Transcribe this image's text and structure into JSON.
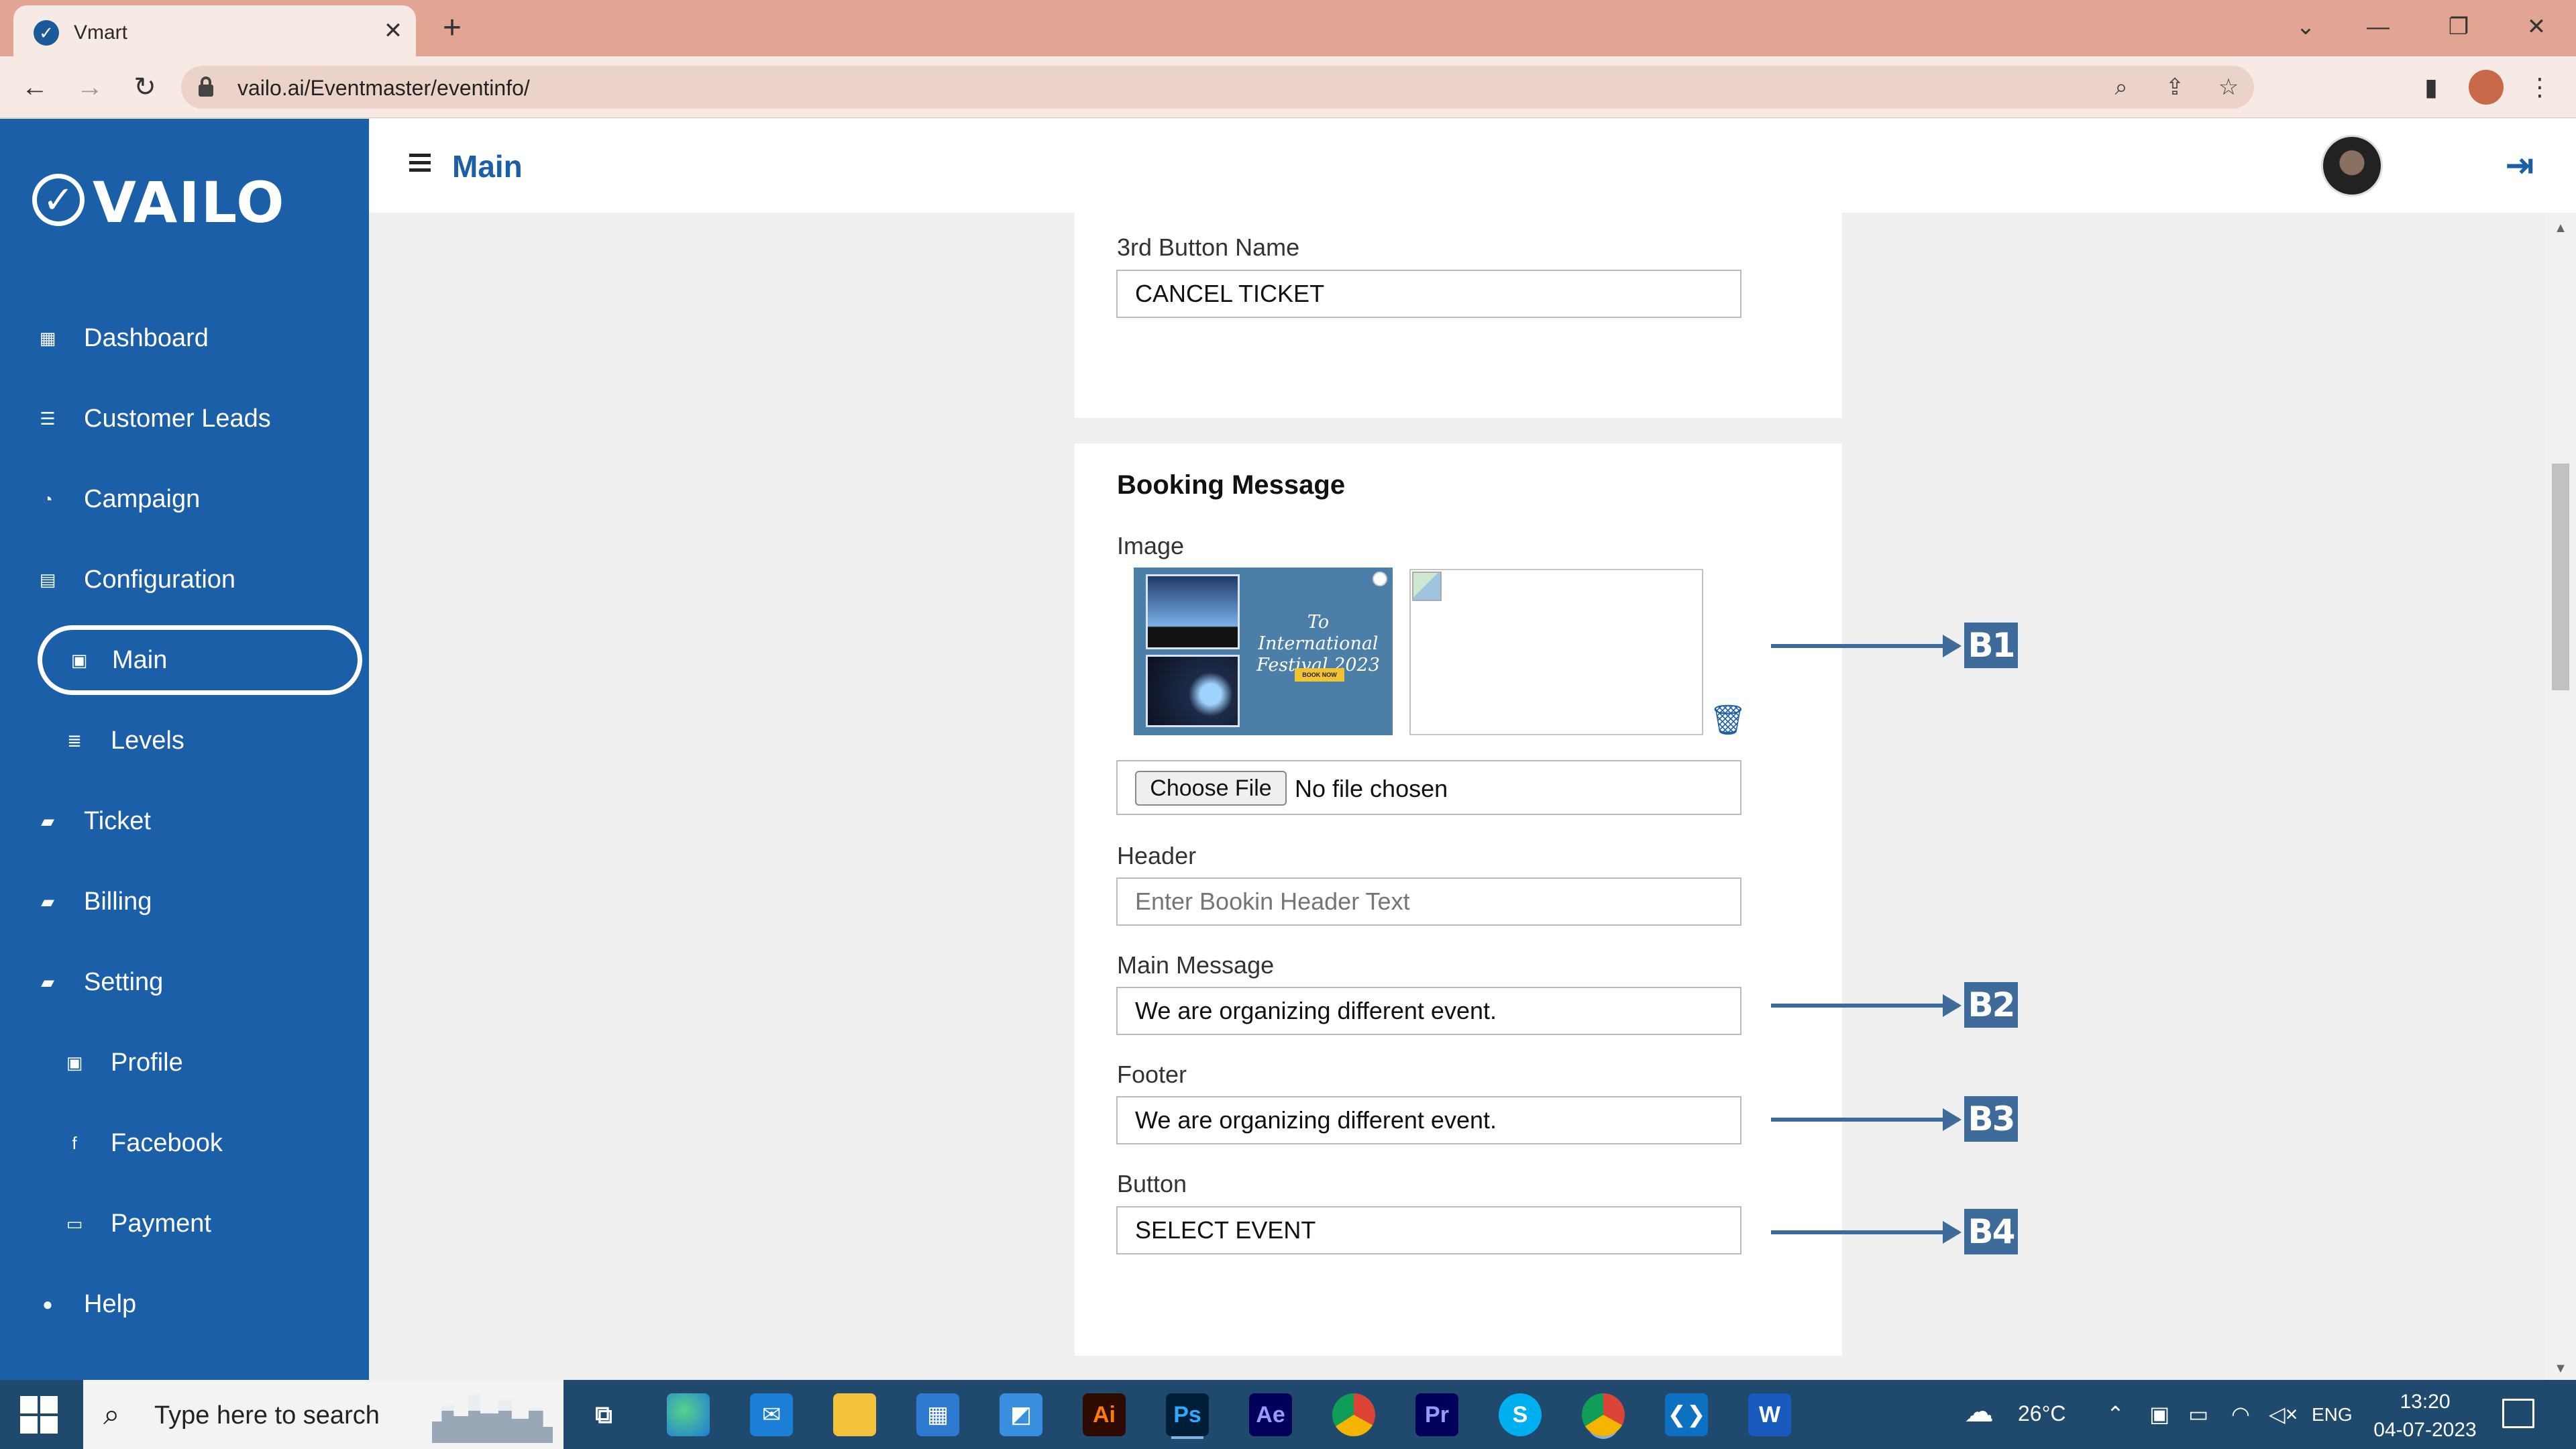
{
  "browser": {
    "tab_title": "Vmart",
    "tab_close": "✕",
    "new_tab": "+",
    "url": "vailo.ai/Eventmaster/eventinfo/"
  },
  "sidebar": {
    "logo_text": "VAILO",
    "items": [
      {
        "label": "Dashboard",
        "icon": "dashboard-icon"
      },
      {
        "label": "Customer Leads",
        "icon": "customer-leads-icon"
      },
      {
        "label": "Campaign",
        "icon": "campaign-icon"
      },
      {
        "label": "Configuration",
        "icon": "configuration-icon"
      },
      {
        "label": "Main",
        "icon": "main-page-icon",
        "active": true
      },
      {
        "label": "Levels",
        "icon": "levels-list-icon"
      },
      {
        "label": "Ticket",
        "icon": "ticket-icon"
      },
      {
        "label": "Billing",
        "icon": "billing-icon"
      },
      {
        "label": "Setting",
        "icon": "setting-icon"
      },
      {
        "label": "Profile",
        "icon": "profile-icon"
      },
      {
        "label": "Facebook",
        "icon": "facebook-icon"
      },
      {
        "label": "Payment",
        "icon": "payment-icon"
      },
      {
        "label": "Help",
        "icon": "help-icon"
      }
    ]
  },
  "header": {
    "title": "Main"
  },
  "third_button": {
    "label": "3rd Button Name",
    "value": "CANCEL TICKET"
  },
  "booking": {
    "title": "Booking Message",
    "image_label": "Image",
    "image_caption": "To International Festival 2023",
    "image_book": "BOOK NOW",
    "choose_file": "Choose File",
    "file_status": "No file chosen",
    "header_label": "Header",
    "header_placeholder": "Enter Bookin Header Text",
    "main_label": "Main Message",
    "main_value": "We are organizing different event.",
    "footer_label": "Footer",
    "footer_value": "We are organizing different event.",
    "button_label": "Button",
    "button_value": "SELECT EVENT"
  },
  "callouts": [
    "B1",
    "B2",
    "B3",
    "B4"
  ],
  "taskbar": {
    "search_text": "Type here to search",
    "apps": [
      "Ai",
      "Ps",
      "Ae",
      "Pr",
      "S"
    ],
    "weather": "26°C",
    "lang": "ENG",
    "time": "13:20",
    "date": "04-07-2023"
  },
  "colors": {
    "sidebar": "#1a5fa8",
    "accent": "#1a5fa8",
    "callout": "#3e6b99",
    "tab_strip": "#e2a593"
  }
}
